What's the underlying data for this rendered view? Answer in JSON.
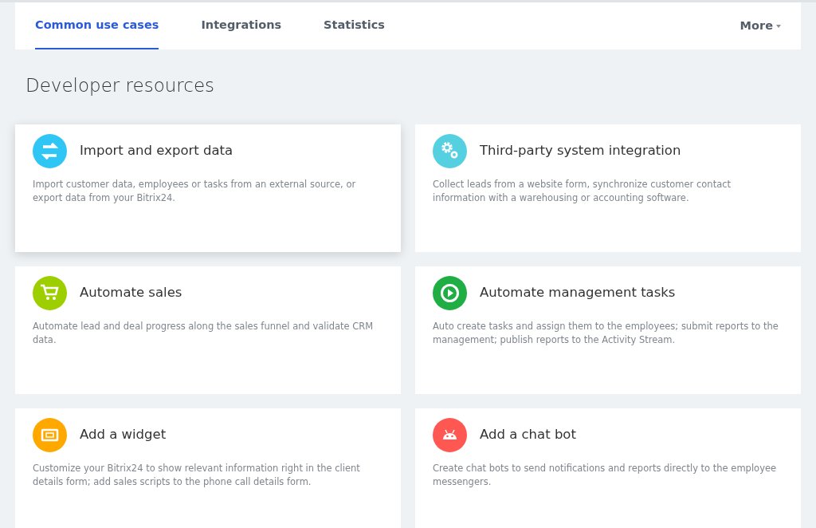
{
  "tabs": [
    {
      "label": "Common use cases",
      "selected": true
    },
    {
      "label": "Integrations",
      "selected": false
    },
    {
      "label": "Statistics",
      "selected": false
    }
  ],
  "more_menu": {
    "label": "More"
  },
  "heading": "Developer resources",
  "cards": [
    {
      "title": "Import and export data",
      "description": "Import customer data, employees or tasks from an external source, or export data from your Bitrix24.",
      "color": "#2fc6f6",
      "hovered": true
    },
    {
      "title": "Third-party system integration",
      "description": "Collect leads from a website form, synchronize customer contact information with a warehousing or accounting software.",
      "color": "#55d0e0",
      "hovered": false
    },
    {
      "title": "Automate sales",
      "description": "Automate lead and deal progress along the sales funnel and validate CRM data.",
      "color": "#9dcf00",
      "hovered": false
    },
    {
      "title": "Automate management tasks",
      "description": "Auto create tasks and assign them to the employees; submit reports to the management; publish reports to the Activity Stream.",
      "color": "#1eae43",
      "hovered": false
    },
    {
      "title": "Add a widget",
      "description": "Customize your Bitrix24 to show relevant information right in the client details form; add sales scripts to the phone call details form.",
      "color": "#ffa900",
      "hovered": false
    },
    {
      "title": "Add a chat bot",
      "description": "Create chat bots to send notifications and reports directly to the employee messengers.",
      "color": "#ff5752",
      "hovered": false
    }
  ]
}
